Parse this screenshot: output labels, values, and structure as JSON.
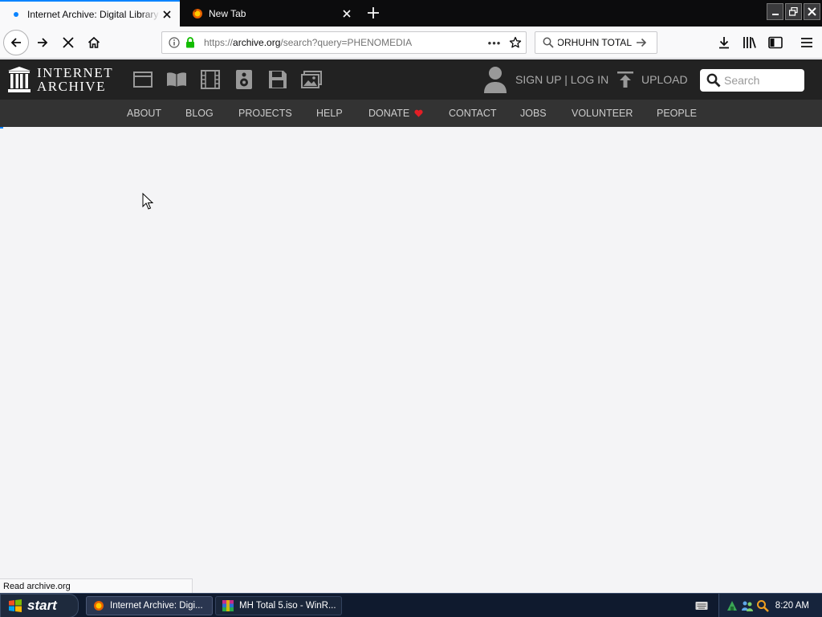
{
  "browser": {
    "tabs": [
      {
        "title": "Internet Archive: Digital Library of",
        "active": true,
        "favicon": "loading-dot"
      },
      {
        "title": "New Tab",
        "active": false,
        "favicon": "tab-icon"
      }
    ],
    "url": {
      "prefix": "https://",
      "host": "archive.org",
      "path": "/search?query=PHENOMEDIA"
    },
    "search_value": "ORHUHN TOTAL",
    "status_text": "Read archive.org"
  },
  "site": {
    "logo_line1": "INTERNET",
    "logo_line2": "ARCHIVE",
    "media_icons": [
      "web-icon",
      "texts-icon",
      "video-icon",
      "audio-icon",
      "software-icon",
      "images-icon"
    ],
    "signin_label": "SIGN UP | LOG IN",
    "upload_label": "UPLOAD",
    "search_placeholder": "Search",
    "nav": [
      "ABOUT",
      "BLOG",
      "PROJECTS",
      "HELP",
      "DONATE",
      "CONTACT",
      "JOBS",
      "VOLUNTEER",
      "PEOPLE"
    ],
    "heart_color": "#e31e25"
  },
  "taskbar": {
    "start_label": "start",
    "tasks": [
      {
        "label": "Internet Archive: Digi...",
        "active": true
      },
      {
        "label": "MH Total 5.iso - WinR...",
        "active": false
      }
    ],
    "clock": "8:20 AM"
  },
  "colors": {
    "accent": "#0a84ff",
    "ia_header": "#222222",
    "ia_nav": "#333333"
  }
}
